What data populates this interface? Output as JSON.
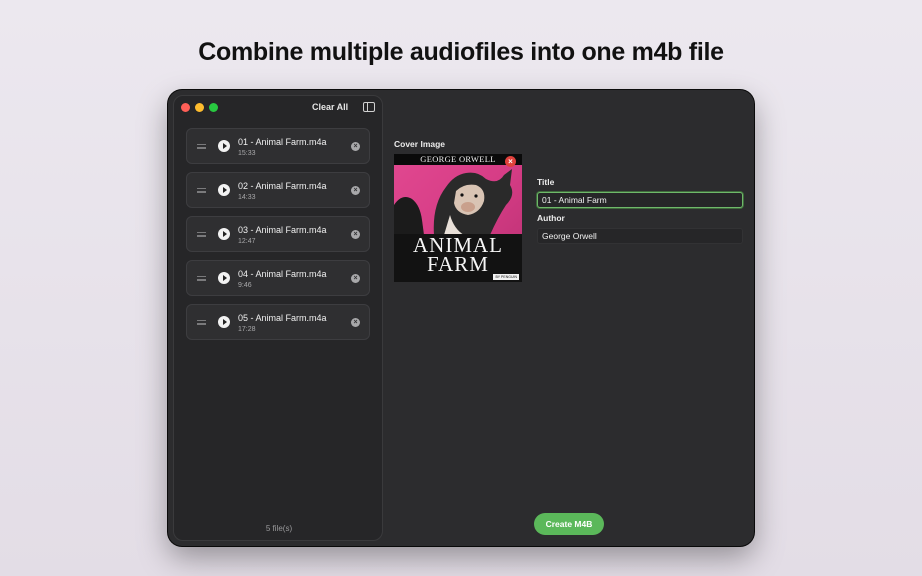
{
  "headline": "Combine multiple audiofiles into one m4b file",
  "toolbar": {
    "clear_all_label": "Clear All"
  },
  "files": [
    {
      "name": "01 - Animal Farm.m4a",
      "duration": "15:33"
    },
    {
      "name": "02 - Animal Farm.m4a",
      "duration": "14:33"
    },
    {
      "name": "03 - Animal Farm.m4a",
      "duration": "12:47"
    },
    {
      "name": "04 - Animal Farm.m4a",
      "duration": "9:46"
    },
    {
      "name": "05 - Animal Farm.m4a",
      "duration": "17:28"
    }
  ],
  "file_count": "5 file(s)",
  "cover": {
    "label": "Cover Image",
    "author_text": "GEORGE ORWELL",
    "title_line1": "ANIMAL",
    "title_line2": "FARM",
    "publisher": "BY PENGUIN"
  },
  "metadata": {
    "title_label": "Title",
    "title_value": "01 - Animal Farm",
    "author_label": "Author",
    "author_value": "George Orwell"
  },
  "actions": {
    "create_label": "Create M4B"
  },
  "colors": {
    "accent": "#5bb85a",
    "window_bg": "#2c2c2e",
    "cover_pink": "#d63d86"
  }
}
